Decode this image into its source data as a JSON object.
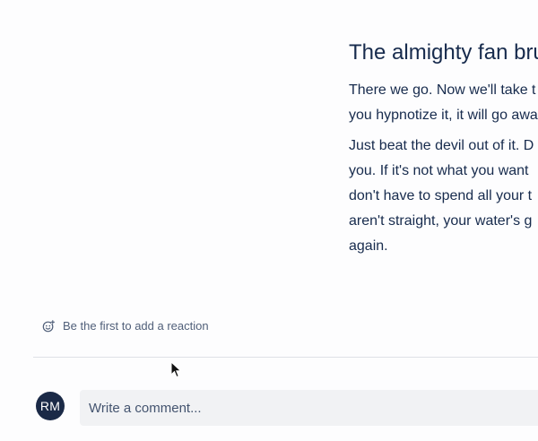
{
  "article": {
    "heading": "The almighty fan brus",
    "paragraph1": [
      "There we go. Now we'll take t",
      "you hypnotize it, it will go awa"
    ],
    "paragraph2": [
      "Just beat the devil out of it. D",
      "you. If it's not what you want",
      "don't have to spend all your t",
      "aren't straight, your water's g",
      "again."
    ]
  },
  "reactions": {
    "icon": "add-reaction-icon",
    "label": "Be the first to add a reaction"
  },
  "comment": {
    "avatar_initials": "RM",
    "placeholder": "Write a comment..."
  },
  "colors": {
    "text": "#172b4d",
    "avatar_bg": "#1b2a47",
    "comment_bg": "#f1f2f4"
  }
}
